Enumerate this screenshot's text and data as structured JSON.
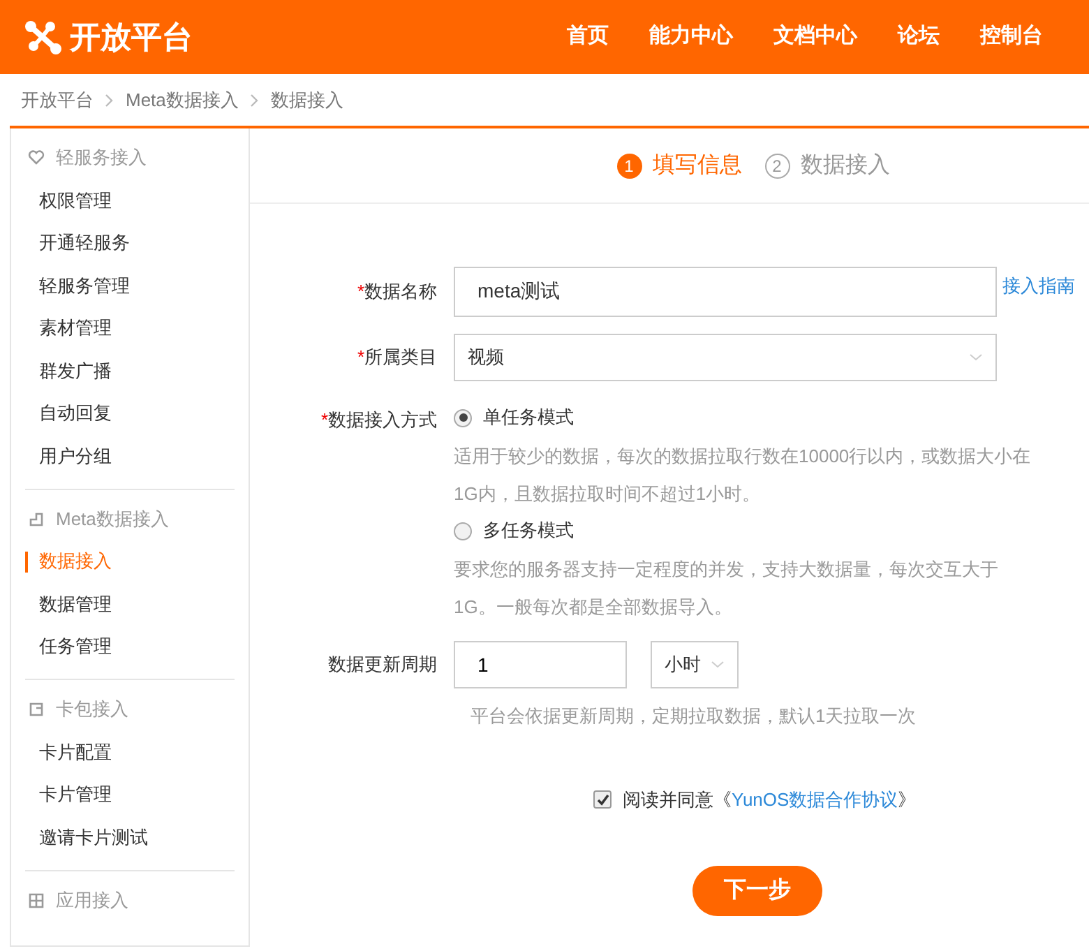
{
  "header": {
    "logo": "开放平台",
    "nav": [
      {
        "label": "首页"
      },
      {
        "label": "能力中心"
      },
      {
        "label": "文档中心"
      },
      {
        "label": "论坛"
      },
      {
        "label": "控制台"
      }
    ]
  },
  "breadcrumb": [
    "开放平台",
    "Meta数据接入",
    "数据接入"
  ],
  "sidebar": [
    {
      "title": "轻服务接入",
      "kind": "heart",
      "items": [
        {
          "label": "权限管理",
          "selected": false
        },
        {
          "label": "开通轻服务",
          "selected": false
        },
        {
          "label": "轻服务管理",
          "selected": false
        },
        {
          "label": "素材管理",
          "selected": false
        },
        {
          "label": "群发广播",
          "selected": false
        },
        {
          "label": "自动回复",
          "selected": false
        },
        {
          "label": "用户分组",
          "selected": false
        }
      ]
    },
    {
      "title": "Meta数据接入",
      "kind": "corner",
      "items": [
        {
          "label": "数据接入",
          "selected": true
        },
        {
          "label": "数据管理",
          "selected": false
        },
        {
          "label": "任务管理",
          "selected": false
        }
      ]
    },
    {
      "title": "卡包接入",
      "kind": "card",
      "items": [
        {
          "label": "卡片配置",
          "selected": false
        },
        {
          "label": "卡片管理",
          "selected": false
        },
        {
          "label": "邀请卡片测试",
          "selected": false
        }
      ]
    },
    {
      "title": "应用接入",
      "kind": "grid"
    }
  ],
  "steps": [
    {
      "number": "1",
      "label": "填写信息",
      "selected": true
    },
    {
      "number": "2",
      "label": "数据接入",
      "selected": false
    }
  ],
  "form": {
    "name": {
      "label": "数据名称",
      "required_mark": "*",
      "value": "meta测试",
      "link": "接入指南"
    },
    "category": {
      "label": "所属类目",
      "required_mark": "*",
      "value": "视频"
    },
    "mode": {
      "label": "数据接入方式",
      "required_mark": "*",
      "options": [
        {
          "label": "单任务模式",
          "selected": true,
          "description": "适用于较少的数据，每次的数据拉取行数在10000行以内，或数据大小在1G内，且数据拉取时间不超过1小时。"
        },
        {
          "label": "多任务模式",
          "selected": false,
          "description": "要求您的服务器支持一定程度的并发，支持大数据量，每次交互大于1G。一般每次都是全部数据导入。"
        }
      ]
    },
    "period": {
      "label": "数据更新周期",
      "value": "1",
      "unit": "小时",
      "hint": "平台会依据更新周期，定期拉取数据，默认1天拉取一次"
    }
  },
  "agreement": {
    "checked": true,
    "text": "阅读并同意《",
    "link": "YunOS数据合作协议",
    "after": "》"
  },
  "next_button": "下一步"
}
